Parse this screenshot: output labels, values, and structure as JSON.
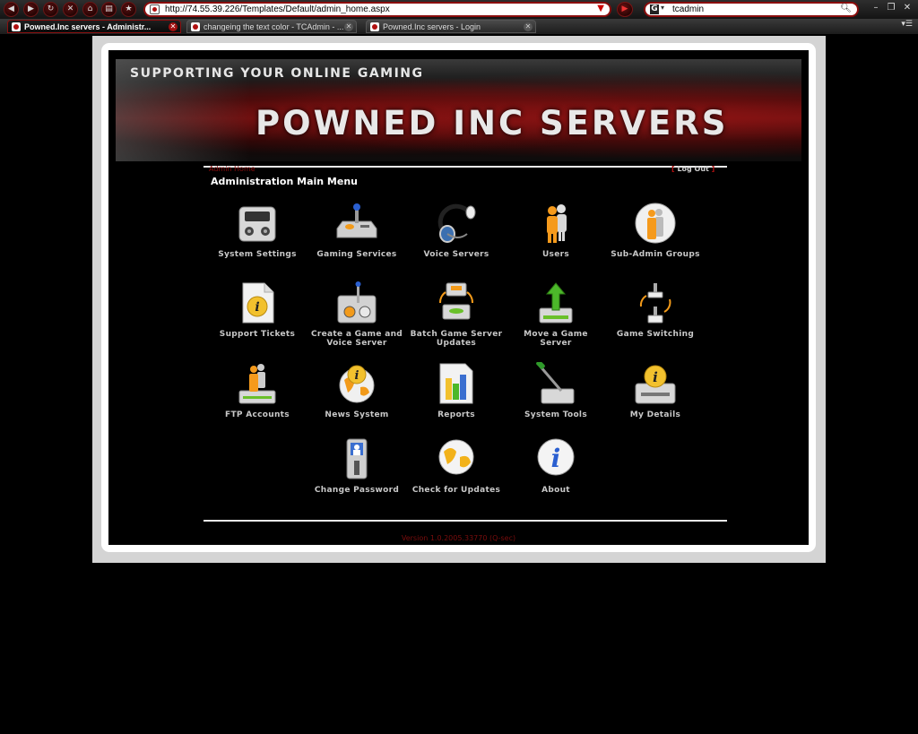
{
  "browser": {
    "address": "http://74.55.39.226/Templates/Default/admin_home.aspx",
    "search_query": "tcadmin",
    "tabs": [
      {
        "label": "Powned.Inc servers - Administr..."
      },
      {
        "label": "changeing the text color - TCAdmin - ..."
      },
      {
        "label": "Powned.Inc servers - Login"
      }
    ]
  },
  "banner": {
    "tagline": "SUPPORTING YOUR ONLINE GAMING",
    "title": "POWNED INC SERVERS"
  },
  "header": {
    "breadcrumb": "Admin Home",
    "logout": "Log Out",
    "title": "Administration Main Menu"
  },
  "menu": [
    {
      "label": "System Settings",
      "icon": "control-panel-icon"
    },
    {
      "label": "Gaming Services",
      "icon": "joystick-icon"
    },
    {
      "label": "Voice Servers",
      "icon": "headset-icon"
    },
    {
      "label": "Users",
      "icon": "users-icon"
    },
    {
      "label": "Sub-Admin Groups",
      "icon": "user-group-icon"
    },
    {
      "label": "Support Tickets",
      "icon": "info-document-icon"
    },
    {
      "label": "Create a Game and Voice Server",
      "icon": "joystick-create-icon"
    },
    {
      "label": "Batch Game Server Updates",
      "icon": "batch-update-icon"
    },
    {
      "label": "Move a Game Server",
      "icon": "move-server-icon"
    },
    {
      "label": "Game Switching",
      "icon": "game-switch-icon"
    },
    {
      "label": "FTP Accounts",
      "icon": "ftp-user-icon"
    },
    {
      "label": "News System",
      "icon": "news-globe-icon"
    },
    {
      "label": "Reports",
      "icon": "reports-icon"
    },
    {
      "label": "System Tools",
      "icon": "tools-icon"
    },
    {
      "label": "My Details",
      "icon": "my-details-icon"
    },
    {
      "label": "Change Password",
      "icon": "password-icon"
    },
    {
      "label": "Check for Updates",
      "icon": "globe-update-icon"
    },
    {
      "label": "About",
      "icon": "about-info-icon"
    }
  ],
  "footer": {
    "version": "Version 1.0.2005.33770    (Q-sec)"
  },
  "colors": {
    "accent": "#8a0d0d",
    "link_red": "#b01010",
    "label_gray": "#c8c8c8"
  }
}
